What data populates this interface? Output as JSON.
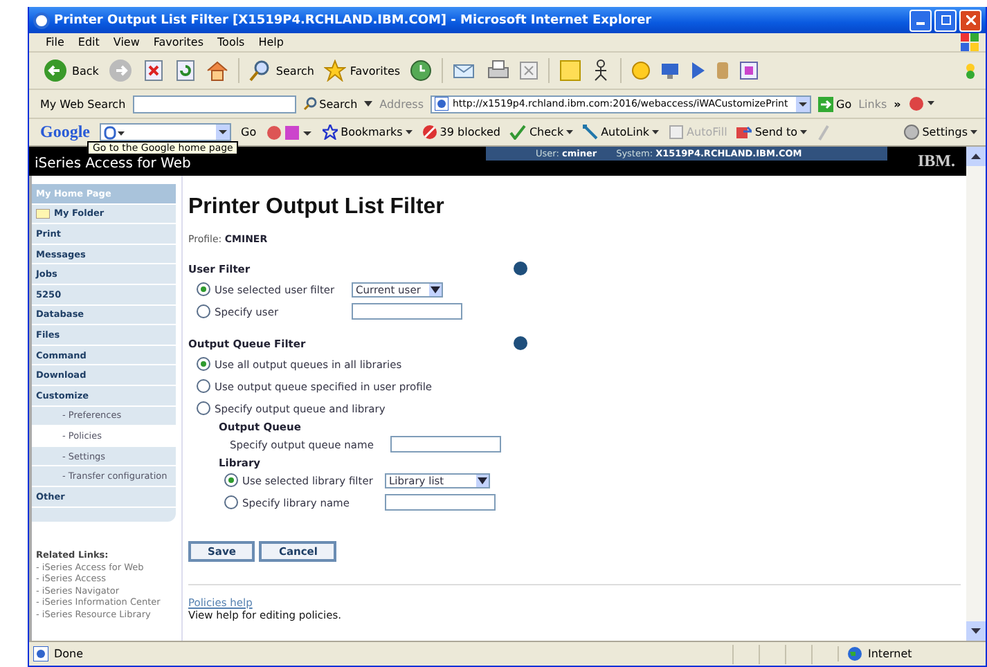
{
  "window": {
    "title": "Printer Output List Filter [X1519P4.RCHLAND.IBM.COM] - Microsoft Internet Explorer"
  },
  "menu": [
    "File",
    "Edit",
    "View",
    "Favorites",
    "Tools",
    "Help"
  ],
  "toolbar": {
    "back": "Back",
    "search": "Search",
    "favorites": "Favorites"
  },
  "address_bar": {
    "search_label": "My Web Search",
    "search_button": "Search",
    "address_label": "Address",
    "url": "http://x1519p4.rchland.ibm.com:2016/webaccess/iWACustomizePrint",
    "go": "Go",
    "links": "Links",
    "more": "»"
  },
  "google_bar": {
    "logo": "Google",
    "go": "Go",
    "bookmarks": "Bookmarks",
    "blocked": "39 blocked",
    "check": "Check",
    "autolink": "AutoLink",
    "autofill": {
      "label": "AutoFill",
      "disabled": true
    },
    "send_to": "Send to",
    "settings": "Settings",
    "tooltip": "Go to the Google home page"
  },
  "header": {
    "product": "iSeries Access for Web",
    "user_label": "User:",
    "user": "cminer",
    "system_label": "System:",
    "system": "X1519P4.RCHLAND.IBM.COM",
    "logo": "IBM."
  },
  "sidebar": {
    "items": [
      {
        "label": "My Home Page",
        "kind": "home",
        "selected": false
      },
      {
        "label": "My Folder",
        "kind": "folder",
        "selected": false
      },
      {
        "label": "Print",
        "kind": "category",
        "selected": false
      },
      {
        "label": "Messages",
        "kind": "category",
        "selected": false
      },
      {
        "label": "Jobs",
        "kind": "category",
        "selected": false
      },
      {
        "label": "5250",
        "kind": "category",
        "selected": false
      },
      {
        "label": "Database",
        "kind": "category",
        "selected": false
      },
      {
        "label": "Files",
        "kind": "category",
        "selected": false
      },
      {
        "label": "Command",
        "kind": "category",
        "selected": false
      },
      {
        "label": "Download",
        "kind": "category",
        "selected": false
      },
      {
        "label": "Customize",
        "kind": "category",
        "selected": false
      },
      {
        "label": "- Preferences",
        "kind": "sub",
        "selected": false
      },
      {
        "label": "- Policies",
        "kind": "sub",
        "selected": true
      },
      {
        "label": "- Settings",
        "kind": "sub",
        "selected": false
      },
      {
        "label": "- Transfer configuration",
        "kind": "sub",
        "selected": false
      },
      {
        "label": "Other",
        "kind": "category",
        "selected": false
      }
    ],
    "related_title": "Related Links:",
    "related": [
      "- iSeries Access for Web",
      "- iSeries Access",
      "- iSeries Navigator",
      "- iSeries Information Center",
      "- iSeries Resource Library"
    ]
  },
  "form": {
    "title": "Printer Output List Filter",
    "profile_label": "Profile:",
    "profile": "CMINER",
    "user_filter": {
      "heading": "User Filter",
      "options": [
        {
          "label": "Use selected user filter",
          "selected": true,
          "control": {
            "kind": "select",
            "value": "Current user"
          }
        },
        {
          "label": "Specify user",
          "selected": false,
          "control": {
            "kind": "text"
          }
        }
      ]
    },
    "queue_filter": {
      "heading": "Output Queue Filter",
      "options": [
        {
          "label": "Use all output queues in all libraries",
          "selected": true
        },
        {
          "label": "Use output queue specified in user profile",
          "selected": false
        },
        {
          "label": "Specify output queue and library",
          "selected": false
        }
      ],
      "output_queue": {
        "heading": "Output Queue",
        "field_label": "Specify output queue name"
      },
      "library": {
        "heading": "Library",
        "options": [
          {
            "label": "Use selected library filter",
            "selected": true,
            "control": {
              "kind": "select",
              "value": "Library list"
            }
          },
          {
            "label": "Specify library name",
            "selected": false,
            "control": {
              "kind": "text"
            }
          }
        ]
      }
    },
    "buttons": [
      "Save",
      "Cancel"
    ],
    "help_link": "Policies help",
    "help_text": "View help for editing policies."
  },
  "status_bar": {
    "text": "Done",
    "zone": "Internet"
  }
}
